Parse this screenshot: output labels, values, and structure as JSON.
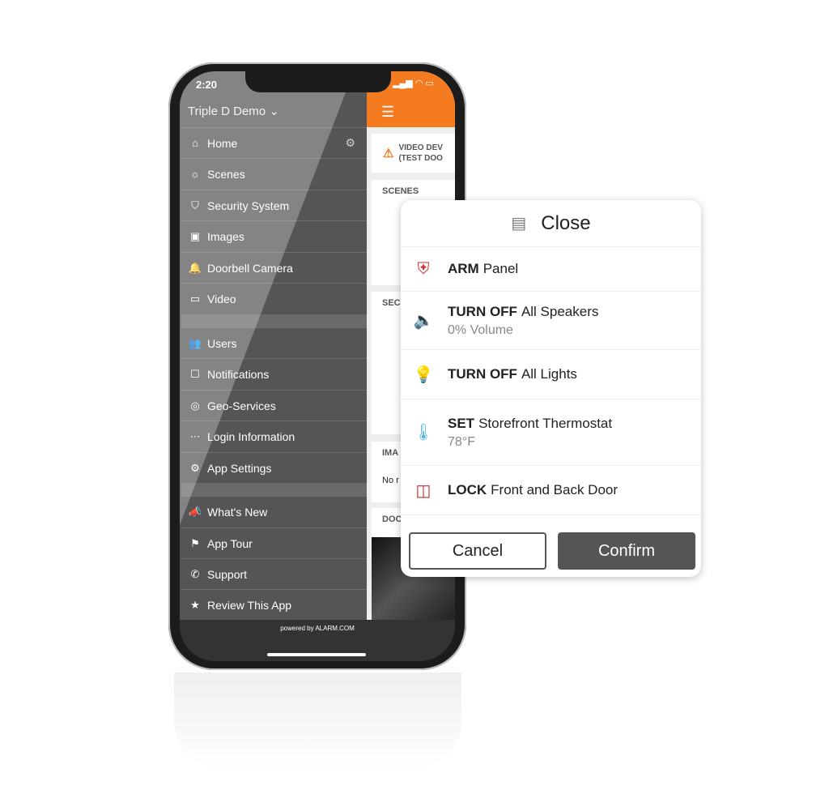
{
  "status": {
    "time": "2:20"
  },
  "sidebar": {
    "account": "Triple D Demo",
    "items": [
      {
        "label": "Home",
        "icon": "home-icon",
        "glyph": "⌂"
      },
      {
        "label": "Scenes",
        "icon": "scenes-icon",
        "glyph": "☼"
      },
      {
        "label": "Security System",
        "icon": "shield-icon",
        "glyph": "⛉"
      },
      {
        "label": "Images",
        "icon": "image-icon",
        "glyph": "▣"
      },
      {
        "label": "Doorbell Camera",
        "icon": "bell-icon",
        "glyph": "🔔"
      },
      {
        "label": "Video",
        "icon": "video-icon",
        "glyph": "▭"
      },
      {
        "label": "Users",
        "icon": "users-icon",
        "glyph": "👥"
      },
      {
        "label": "Notifications",
        "icon": "notification-icon",
        "glyph": "☐"
      },
      {
        "label": "Geo-Services",
        "icon": "compass-icon",
        "glyph": "◎"
      },
      {
        "label": "Login Information",
        "icon": "login-icon",
        "glyph": "⋯"
      },
      {
        "label": "App Settings",
        "icon": "settings-icon",
        "glyph": "⚙"
      },
      {
        "label": "What's New",
        "icon": "megaphone-icon",
        "glyph": "📣"
      },
      {
        "label": "App Tour",
        "icon": "signpost-icon",
        "glyph": "⚑"
      },
      {
        "label": "Support",
        "icon": "phone-icon",
        "glyph": "✆"
      },
      {
        "label": "Review This App",
        "icon": "star-icon",
        "glyph": "★"
      }
    ],
    "footer": "powered by ALARM.COM"
  },
  "main": {
    "alert": "VIDEO DEV (TEST DOO",
    "sections": [
      "SCENES",
      "SEC",
      "IMA",
      "DOC"
    ],
    "images_empty": "No r"
  },
  "modal": {
    "title": "Close",
    "rows": [
      {
        "action": "ARM",
        "target": "Panel",
        "icon": "shield-check-icon",
        "color": "#d32f2f"
      },
      {
        "action": "TURN OFF",
        "target": "All Speakers",
        "detail": "0% Volume",
        "icon": "speaker-icon",
        "color": "#222222"
      },
      {
        "action": "TURN OFF",
        "target": "All Lights",
        "icon": "lightbulb-icon",
        "color": "#f5d327"
      },
      {
        "action": "SET",
        "target": "Storefront Thermostat",
        "detail": "78°F",
        "icon": "thermostat-icon",
        "color": "#4db6d6"
      },
      {
        "action": "LOCK",
        "target": "Front and Back Door",
        "icon": "door-lock-icon",
        "color": "#c62828"
      }
    ],
    "cancel": "Cancel",
    "confirm": "Confirm"
  },
  "colors": {
    "accent": "#f47b20"
  }
}
